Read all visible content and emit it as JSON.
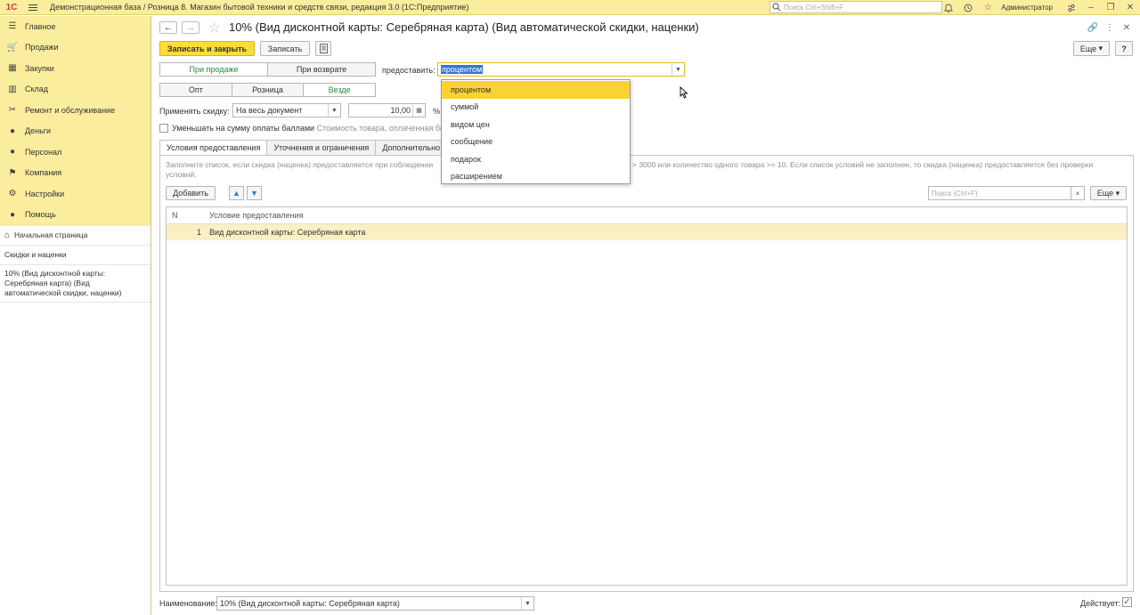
{
  "topbar": {
    "logo": "1С",
    "title": "Демонстрационная база / Розница 8. Магазин бытовой техники и средств связи, редакция 3.0  (1С:Предприятие)",
    "search_placeholder": "Поиск Ctrl+Shift+F",
    "user": "Администратор"
  },
  "sidebar": {
    "items": [
      {
        "label": "Главное",
        "icon": "menu-lines-icon"
      },
      {
        "label": "Продажи",
        "icon": "shopping-icon"
      },
      {
        "label": "Закупки",
        "icon": "truck-icon"
      },
      {
        "label": "Склад",
        "icon": "warehouse-icon"
      },
      {
        "label": "Ремонт и обслуживание",
        "icon": "tools-icon"
      },
      {
        "label": "Деньги",
        "icon": "money-icon"
      },
      {
        "label": "Персонал",
        "icon": "person-icon"
      },
      {
        "label": "Компания",
        "icon": "flag-icon"
      },
      {
        "label": "Настройки",
        "icon": "gear-icon"
      },
      {
        "label": "Помощь",
        "icon": "help-icon"
      }
    ],
    "home": "Начальная страница",
    "open_windows": [
      "Скидки и наценки",
      "10% (Вид дисконтной карты: Серебряная карта) (Вид автоматической скидки, наценки)"
    ]
  },
  "header": {
    "title": "10% (Вид дисконтной карты: Серебряная карта) (Вид автоматической скидки, наценки)"
  },
  "toolbar": {
    "save_close": "Записать и закрыть",
    "save": "Записать",
    "more": "Еще",
    "help": "?"
  },
  "form": {
    "mode_tabs": [
      "При продаже",
      "При возврате"
    ],
    "provide_label": "предоставить:",
    "provide_value": "процентом",
    "scope_tabs": [
      "Опт",
      "Розница",
      "Везде"
    ],
    "apply_label": "Применять скидку:",
    "apply_value": "На весь документ",
    "amount_value": "10,00",
    "percent_sign": "%",
    "reduce_label": "Уменьшать на сумму оплаты баллами",
    "reduce_note": "Стоимость товара, оплаченная бону"
  },
  "dropdown": {
    "options": [
      "процентом",
      "суммой",
      "видом цен",
      "сообщение",
      "подарок",
      "расширением"
    ],
    "highlighted": 0
  },
  "tabs": [
    "Условия предоставления",
    "Уточнения и ограничения",
    "Дополнительно"
  ],
  "conditions": {
    "hint_left": "Заполните список, если скидка (наценка) предоставляется при соблюдении",
    "hint_left2": "условий.",
    "hint_right": "> 3000 или количество одного товара >= 10. Если список условий не заполнен, то скидка (наценка) предоставляется без проверки",
    "add_button": "Добавить",
    "search_placeholder": "Поиск (Ctrl+F)",
    "clear": "×",
    "more": "Еще",
    "columns": [
      "N",
      "Условие предоставления"
    ],
    "rows": [
      {
        "n": "1",
        "condition": "Вид дисконтной карты: Серебряная карта"
      }
    ]
  },
  "footer": {
    "name_label": "Наименование:",
    "name_value": "10% (Вид дисконтной карты: Серебряная карта)",
    "active_label": "Действует:",
    "active_check": "✓"
  },
  "colors": {
    "accent_yellow": "#fadd36",
    "panel_yellow": "#fbed9e",
    "selected_row": "#fbf0c4",
    "green_active": "#2a8a3b"
  }
}
